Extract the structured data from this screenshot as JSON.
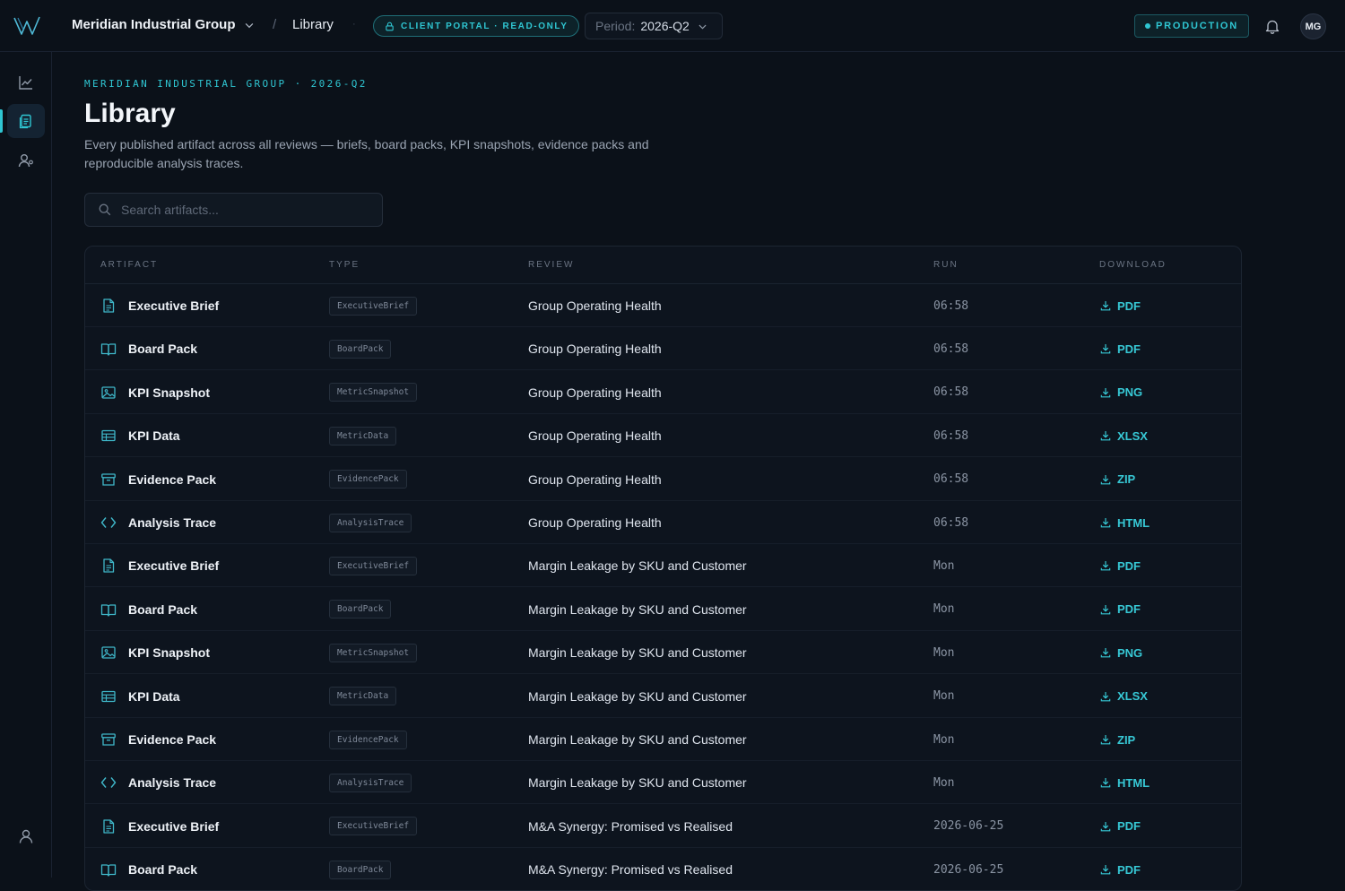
{
  "header": {
    "org_name": "Meridian Industrial Group",
    "crumb_separator": "/",
    "crumb_page": "Library",
    "dot_separator": "·",
    "portal_badge": "CLIENT PORTAL · READ-ONLY",
    "period_label": "Period:",
    "period_value": "2026-Q2",
    "env_badge": "PRODUCTION",
    "avatar_initials": "MG"
  },
  "sidebar": {
    "items": [
      {
        "name": "analytics",
        "icon": "trend-chart-icon",
        "active": false
      },
      {
        "name": "library",
        "icon": "documents-icon",
        "active": true
      },
      {
        "name": "users",
        "icon": "user-settings-icon",
        "active": false
      },
      {
        "name": "profile",
        "icon": "user-icon",
        "active": false
      }
    ]
  },
  "page": {
    "eyebrow": "MERIDIAN INDUSTRIAL GROUP · 2026-Q2",
    "title": "Library",
    "description": "Every published artifact across all reviews — briefs, board packs, KPI snapshots, evidence packs and reproducible analysis traces.",
    "search_placeholder": "Search artifacts..."
  },
  "table": {
    "headers": [
      "ARTIFACT",
      "TYPE",
      "REVIEW",
      "RUN",
      "DOWNLOAD"
    ],
    "rows": [
      {
        "artifact": "Executive Brief",
        "icon": "document-icon",
        "type": "ExecutiveBrief",
        "review": "Group Operating Health",
        "run": "06:58",
        "download": "PDF"
      },
      {
        "artifact": "Board Pack",
        "icon": "book-icon",
        "type": "BoardPack",
        "review": "Group Operating Health",
        "run": "06:58",
        "download": "PDF"
      },
      {
        "artifact": "KPI Snapshot",
        "icon": "image-icon",
        "type": "MetricSnapshot",
        "review": "Group Operating Health",
        "run": "06:58",
        "download": "PNG"
      },
      {
        "artifact": "KPI Data",
        "icon": "table-icon",
        "type": "MetricData",
        "review": "Group Operating Health",
        "run": "06:58",
        "download": "XLSX"
      },
      {
        "artifact": "Evidence Pack",
        "icon": "archive-icon",
        "type": "EvidencePack",
        "review": "Group Operating Health",
        "run": "06:58",
        "download": "ZIP"
      },
      {
        "artifact": "Analysis Trace",
        "icon": "code-icon",
        "type": "AnalysisTrace",
        "review": "Group Operating Health",
        "run": "06:58",
        "download": "HTML"
      },
      {
        "artifact": "Executive Brief",
        "icon": "document-icon",
        "type": "ExecutiveBrief",
        "review": "Margin Leakage by SKU and Customer",
        "run": "Mon",
        "download": "PDF"
      },
      {
        "artifact": "Board Pack",
        "icon": "book-icon",
        "type": "BoardPack",
        "review": "Margin Leakage by SKU and Customer",
        "run": "Mon",
        "download": "PDF"
      },
      {
        "artifact": "KPI Snapshot",
        "icon": "image-icon",
        "type": "MetricSnapshot",
        "review": "Margin Leakage by SKU and Customer",
        "run": "Mon",
        "download": "PNG"
      },
      {
        "artifact": "KPI Data",
        "icon": "table-icon",
        "type": "MetricData",
        "review": "Margin Leakage by SKU and Customer",
        "run": "Mon",
        "download": "XLSX"
      },
      {
        "artifact": "Evidence Pack",
        "icon": "archive-icon",
        "type": "EvidencePack",
        "review": "Margin Leakage by SKU and Customer",
        "run": "Mon",
        "download": "ZIP"
      },
      {
        "artifact": "Analysis Trace",
        "icon": "code-icon",
        "type": "AnalysisTrace",
        "review": "Margin Leakage by SKU and Customer",
        "run": "Mon",
        "download": "HTML"
      },
      {
        "artifact": "Executive Brief",
        "icon": "document-icon",
        "type": "ExecutiveBrief",
        "review": "M&A Synergy: Promised vs Realised",
        "run": "2026-06-25",
        "download": "PDF"
      },
      {
        "artifact": "Board Pack",
        "icon": "book-icon",
        "type": "BoardPack",
        "review": "M&A Synergy: Promised vs Realised",
        "run": "2026-06-25",
        "download": "PDF"
      }
    ]
  },
  "colors": {
    "accent": "#2fc6d2",
    "background": "#0b1119",
    "panel": "#0d141e"
  }
}
